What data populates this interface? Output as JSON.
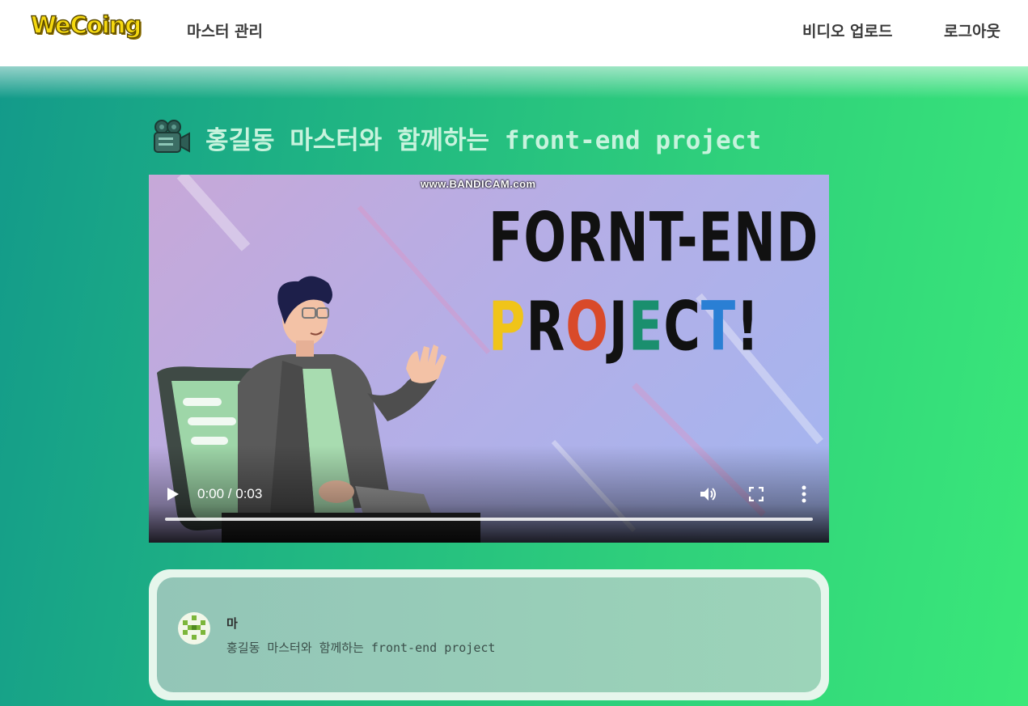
{
  "header": {
    "logo": "WeCoing",
    "nav_master": "마스터 관리",
    "nav_upload": "비디오 업로드",
    "nav_logout": "로그아웃"
  },
  "main": {
    "title_icon": "movie-camera-icon",
    "title": "홍길동 마스터와 함께하는 front-end project"
  },
  "video": {
    "watermark": "www.BANDICAM.com",
    "headline_line1": "FORNT-END",
    "headline_line2": [
      "P",
      "R",
      "O",
      "J",
      "E",
      "C",
      "T",
      "!"
    ],
    "headline_line2_colors": [
      "#f0c419",
      "#111111",
      "#d94a2a",
      "#111111",
      "#1a8f6e",
      "#111111",
      "#2a7fd4",
      "#111111"
    ],
    "time": "0:00 / 0:03",
    "progress": 0.0,
    "icons": [
      "play-icon",
      "volume-icon",
      "fullscreen-icon",
      "more-vert-icon"
    ]
  },
  "card": {
    "name": "마",
    "description": "홍길동 마스터와 함께하는 front-end project",
    "avatar_icon": "identicon-avatar"
  },
  "colors": {
    "gradient_start": "#139a8a",
    "gradient_end": "#3ae879",
    "logo_yellow": "#f5d80f",
    "title_mint": "#c7f3dd"
  }
}
